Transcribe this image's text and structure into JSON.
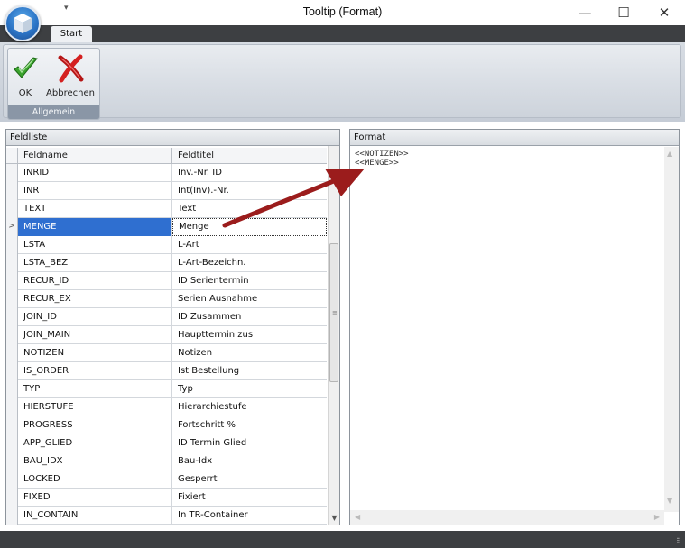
{
  "window": {
    "title": "Tooltip (Format)",
    "minimize": "—",
    "maximize": "☐",
    "close": "✕",
    "qat_arrow": "▾"
  },
  "ribbon": {
    "tab_start": "Start",
    "group": {
      "caption": "Allgemein",
      "ok_label": "OK",
      "cancel_label": "Abbrechen"
    }
  },
  "feldliste": {
    "title": "Feldliste",
    "columns": [
      "Feldname",
      "Feldtitel"
    ],
    "rows": [
      {
        "name": "INRID",
        "title": "Inv.-Nr. ID"
      },
      {
        "name": "INR",
        "title": "Int(Inv).-Nr."
      },
      {
        "name": "TEXT",
        "title": "Text"
      },
      {
        "name": "MENGE",
        "title": "Menge",
        "selected": true
      },
      {
        "name": "LSTA",
        "title": "L-Art"
      },
      {
        "name": "LSTA_BEZ",
        "title": "L-Art-Bezeichn."
      },
      {
        "name": "RECUR_ID",
        "title": "ID Serientermin"
      },
      {
        "name": "RECUR_EX",
        "title": "Serien Ausnahme"
      },
      {
        "name": "JOIN_ID",
        "title": "ID Zusammen"
      },
      {
        "name": "JOIN_MAIN",
        "title": "Haupttermin zus"
      },
      {
        "name": "NOTIZEN",
        "title": "Notizen"
      },
      {
        "name": "IS_ORDER",
        "title": "Ist Bestellung"
      },
      {
        "name": "TYP",
        "title": "Typ"
      },
      {
        "name": "HIERSTUFE",
        "title": "Hierarchiestufe"
      },
      {
        "name": "PROGRESS",
        "title": "Fortschritt %"
      },
      {
        "name": "APP_GLIED",
        "title": "ID Termin Glied"
      },
      {
        "name": "BAU_IDX",
        "title": "Bau-Idx"
      },
      {
        "name": "LOCKED",
        "title": "Gesperrt"
      },
      {
        "name": "FIXED",
        "title": "Fixiert"
      },
      {
        "name": "IN_CONTAIN",
        "title": "In TR-Container"
      }
    ],
    "row_marker": ">",
    "scroll_grip": "≡",
    "scroll_down": "▼"
  },
  "format": {
    "title": "Format",
    "text": "<<NOTIZEN>>\n<<MENGE>>",
    "scroll_up": "▲",
    "scroll_down": "▼",
    "scroll_left": "◀",
    "scroll_right": "▶"
  },
  "statusbar": {
    "grip": "⠿"
  },
  "colors": {
    "selection": "#2f6fd0",
    "arrow": "#9b1c1c",
    "dark_bar": "#3d3f42"
  }
}
